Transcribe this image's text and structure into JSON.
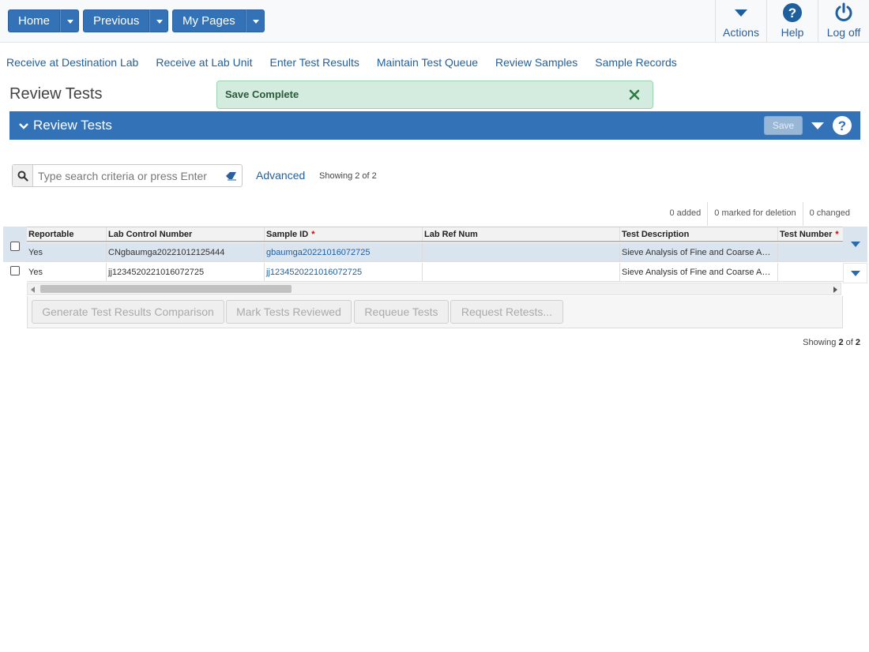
{
  "topbar": {
    "home": "Home",
    "previous": "Previous",
    "my_pages": "My Pages",
    "actions": "Actions",
    "help": "Help",
    "logoff": "Log off"
  },
  "nav": [
    "Receive at Destination Lab",
    "Receive at Lab Unit",
    "Enter Test Results",
    "Maintain Test Queue",
    "Review Samples",
    "Sample Records"
  ],
  "page_title": "Review Tests",
  "toast": {
    "message": "Save Complete"
  },
  "panel": {
    "title": "Review Tests",
    "save_label": "Save"
  },
  "search": {
    "placeholder": "Type search criteria or press Enter",
    "value": "",
    "advanced": "Advanced",
    "showing": "Showing 2 of 2"
  },
  "counters": {
    "added": "0 added",
    "deleted": "0 marked for deletion",
    "changed": "0 changed"
  },
  "grid": {
    "columns": {
      "reportable": "Reportable",
      "lab_control_number": "Lab Control Number",
      "sample_id": "Sample ID",
      "lab_ref_num": "Lab Ref Num",
      "test_description": "Test Description",
      "test_number": "Test Number"
    },
    "rows": [
      {
        "reportable": "Yes",
        "lab_control_number": "CNgbaumga20221012125444",
        "sample_id": "gbaumga20221016072725",
        "lab_ref_num": "",
        "test_description": "Sieve Analysis of Fine and Coarse Aggregates",
        "test_number": "",
        "selected": true
      },
      {
        "reportable": "Yes",
        "lab_control_number": "jj1234520221016072725",
        "sample_id": "jj1234520221016072725",
        "lab_ref_num": "",
        "test_description": "Sieve Analysis of Fine and Coarse Aggregates",
        "test_number": "",
        "selected": false
      }
    ]
  },
  "actions": {
    "generate": "Generate Test Results Comparison",
    "mark_reviewed": "Mark Tests Reviewed",
    "requeue": "Requeue Tests",
    "retests": "Request Retests..."
  },
  "footer": {
    "showing_prefix": "Showing",
    "showing_count": "2",
    "showing_of": "of",
    "showing_total": "2"
  },
  "colors": {
    "primary": "#3472b8",
    "link": "#1f5f9e",
    "success_bg": "#d4ecdf",
    "required": "#cc0000"
  }
}
